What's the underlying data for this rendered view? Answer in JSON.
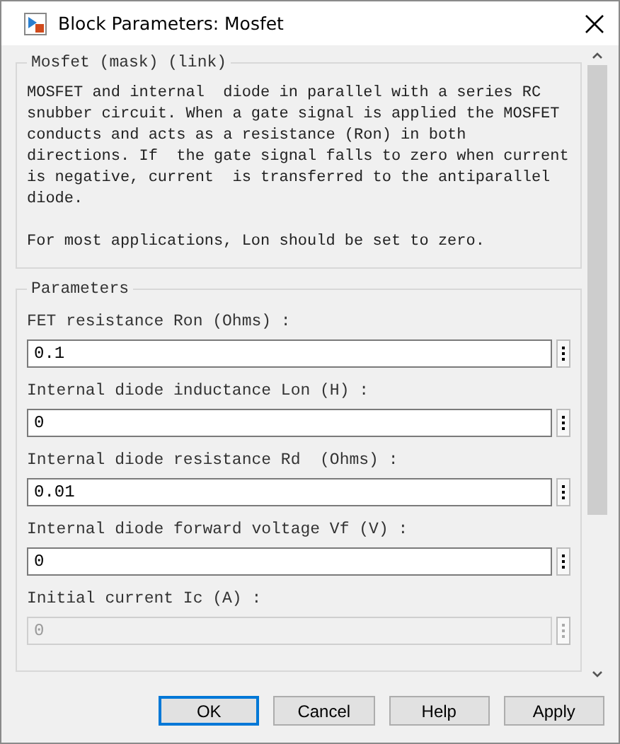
{
  "window": {
    "title": "Block Parameters: Mosfet"
  },
  "description": {
    "title": "Mosfet (mask) (link)",
    "paragraphs": [
      "MOSFET and internal  diode in parallel with a series RC\nsnubber circuit. When a gate signal is applied the MOSFET\nconducts and acts as a resistance (Ron) in both\ndirections. If  the gate signal falls to zero when current\nis negative, current  is transferred to the antiparallel\ndiode.",
      "For most applications, Lon should be set to zero."
    ]
  },
  "parameters": {
    "title": "Parameters",
    "items": [
      {
        "label": "FET resistance Ron (Ohms) :",
        "value": "0.1",
        "disabled": false
      },
      {
        "label": "Internal diode inductance Lon (H) :",
        "value": "0",
        "disabled": false
      },
      {
        "label": "Internal diode resistance Rd  (Ohms) :",
        "value": "0.01",
        "disabled": false
      },
      {
        "label": "Internal diode forward voltage Vf (V) :",
        "value": "0",
        "disabled": false
      },
      {
        "label": "Initial current Ic (A) :",
        "value": "0",
        "disabled": true
      }
    ]
  },
  "buttons": [
    {
      "label": "OK",
      "focused": true
    },
    {
      "label": "Cancel",
      "focused": false
    },
    {
      "label": "Help",
      "focused": false
    },
    {
      "label": "Apply",
      "focused": false
    }
  ]
}
